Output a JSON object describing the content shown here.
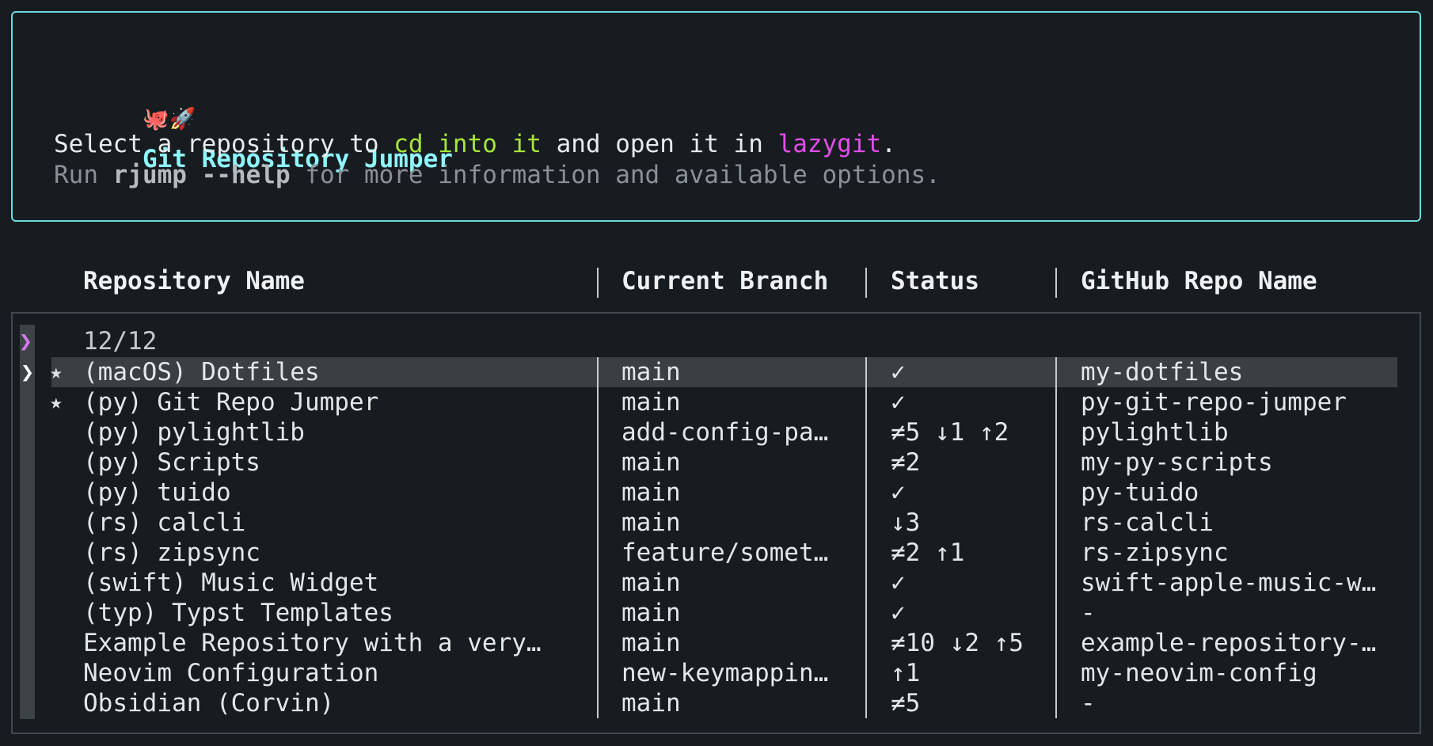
{
  "header": {
    "icons": [
      "octopus-emoji",
      "rocket-emoji"
    ],
    "emoji": "🐙🚀",
    "title": "Git Repository Jumper",
    "desc_part1": "Select a repository to ",
    "desc_highlight": "cd into it",
    "desc_part2": " and open it in ",
    "desc_app": "lazygit",
    "desc_end": ".",
    "help_prefix": "Run ",
    "help_cmd": "rjump --help",
    "help_suffix": " for more information and available options."
  },
  "columns": [
    "Repository Name",
    "Current Branch",
    "Status",
    "GitHub Repo Name"
  ],
  "prompt": {
    "char": "❯",
    "count": "12/12"
  },
  "cursor_char": "❯",
  "star_char": "★",
  "colors": {
    "border_accent": "#6fd9df",
    "title": "#8ef6ff",
    "highlight_green": "#a7e63a",
    "highlight_magenta": "#e34de9",
    "prompt": "#d07ae8"
  },
  "rows": [
    {
      "starred": true,
      "selected": true,
      "name": "(macOS) Dotfiles",
      "branch": "main",
      "status": "✓",
      "github": "my-dotfiles"
    },
    {
      "starred": true,
      "selected": false,
      "name": "(py) Git Repo Jumper",
      "branch": "main",
      "status": "✓",
      "github": "py-git-repo-jumper"
    },
    {
      "starred": false,
      "selected": false,
      "name": "(py) pylightlib",
      "branch": "add-config-pa…",
      "status": "≠5 ↓1 ↑2",
      "github": "pylightlib"
    },
    {
      "starred": false,
      "selected": false,
      "name": "(py) Scripts",
      "branch": "main",
      "status": "≠2",
      "github": "my-py-scripts"
    },
    {
      "starred": false,
      "selected": false,
      "name": "(py) tuido",
      "branch": "main",
      "status": "✓",
      "github": "py-tuido"
    },
    {
      "starred": false,
      "selected": false,
      "name": "(rs) calcli",
      "branch": "main",
      "status": "↓3",
      "github": "rs-calcli"
    },
    {
      "starred": false,
      "selected": false,
      "name": "(rs) zipsync",
      "branch": "feature/somet…",
      "status": "≠2 ↑1",
      "github": "rs-zipsync"
    },
    {
      "starred": false,
      "selected": false,
      "name": "(swift) Music Widget",
      "branch": "main",
      "status": "✓",
      "github": "swift-apple-music-w…"
    },
    {
      "starred": false,
      "selected": false,
      "name": "(typ) Typst Templates",
      "branch": "main",
      "status": "✓",
      "github": "-"
    },
    {
      "starred": false,
      "selected": false,
      "name": "Example Repository with a very…",
      "branch": "main",
      "status": "≠10 ↓2 ↑5",
      "github": "example-repository-…"
    },
    {
      "starred": false,
      "selected": false,
      "name": "Neovim Configuration",
      "branch": "new-keymappin…",
      "status": "↑1",
      "github": "my-neovim-config"
    },
    {
      "starred": false,
      "selected": false,
      "name": "Obsidian (Corvin)",
      "branch": "main",
      "status": "≠5",
      "github": "-"
    }
  ]
}
